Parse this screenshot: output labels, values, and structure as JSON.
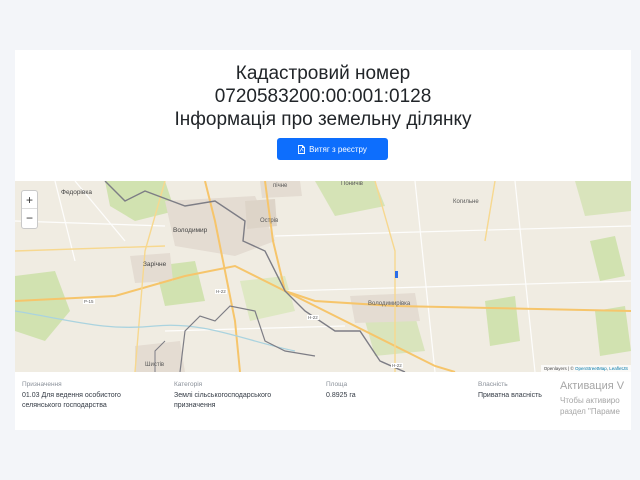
{
  "header": {
    "title_line1": "Кадастровий номер",
    "title_line2": "0720583200:00:001:0128",
    "title_line3": "Інформація про земельну ділянку",
    "extract_button": "Витяг з реєстру"
  },
  "map": {
    "zoom_in": "+",
    "zoom_out": "−",
    "attribution_prefix": "Openlayers | © ",
    "attribution_osm": "OpenStreetMap",
    "attribution_sep": ", ",
    "attribution_leaflet": "LeafletJS",
    "places": {
      "fedorivka": "Федорівка",
      "volodymyr": "Володимир",
      "ostriv": "Острів",
      "zarichchia": "Зарічне",
      "nichne": "пічне",
      "ponychiv": "Поничів",
      "kohylne": "Когильне",
      "volodymyrivka": "Володимирівка",
      "shystiv": "Шистів",
      "r15": "Р-15",
      "h22a": "Н-22",
      "h22b": "Н-22",
      "h22c": "Н-22"
    }
  },
  "info": {
    "purpose_label": "Призначення",
    "purpose_value": "01.03 Для ведення особистого селянського господарства",
    "category_label": "Категорія",
    "category_value": "Землі сільськогосподарського призначення",
    "area_label": "Площа",
    "area_value": "0.8925 га",
    "ownership_label": "Власність",
    "ownership_value": "Приватна власність"
  },
  "os_overlay": {
    "line1": "Активация V",
    "line2": "Чтобы активиро",
    "line3": "раздел \"Параме"
  },
  "colors": {
    "primary": "#0d6efd",
    "map_land": "#f0ece2",
    "map_green": "#c8df9f",
    "map_boundary": "#7d7d85",
    "map_road": "#f6c56b"
  }
}
